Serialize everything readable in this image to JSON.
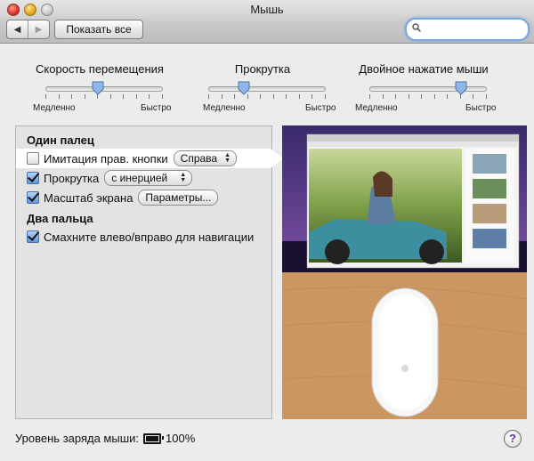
{
  "window": {
    "title": "Мышь"
  },
  "toolbar": {
    "back_icon": "back-arrow-icon",
    "forward_icon": "forward-arrow-icon",
    "show_all_label": "Показать все",
    "search": {
      "value": "",
      "placeholder": ""
    }
  },
  "sliders": [
    {
      "title": "Скорость перемещения",
      "min_label": "Медленно",
      "max_label": "Быстро",
      "value_fraction": 0.45
    },
    {
      "title": "Прокрутка",
      "min_label": "Медленно",
      "max_label": "Быстро",
      "value_fraction": 0.3
    },
    {
      "title": "Двойное нажатие мыши",
      "min_label": "Медленно",
      "max_label": "Быстро",
      "value_fraction": 0.78
    }
  ],
  "one_finger": {
    "title": "Один палец",
    "secondary_click": {
      "label": "Имитация прав. кнопки",
      "checked": false,
      "option": "Справа"
    },
    "scrolling": {
      "label": "Прокрутка",
      "checked": true,
      "option": "с инерцией"
    },
    "screen_zoom": {
      "label": "Масштаб экрана",
      "checked": true,
      "button": "Параметры..."
    }
  },
  "two_fingers": {
    "title": "Два пальца",
    "swipe": {
      "label": "Смахните влево/вправо для навигации",
      "checked": true
    }
  },
  "battery": {
    "label": "Уровень заряда мыши:",
    "value": "100%",
    "level_fraction": 1.0
  },
  "help": {
    "label": "?"
  },
  "colors": {
    "accent": "#5e97e0",
    "help": "#6a2fa0"
  }
}
